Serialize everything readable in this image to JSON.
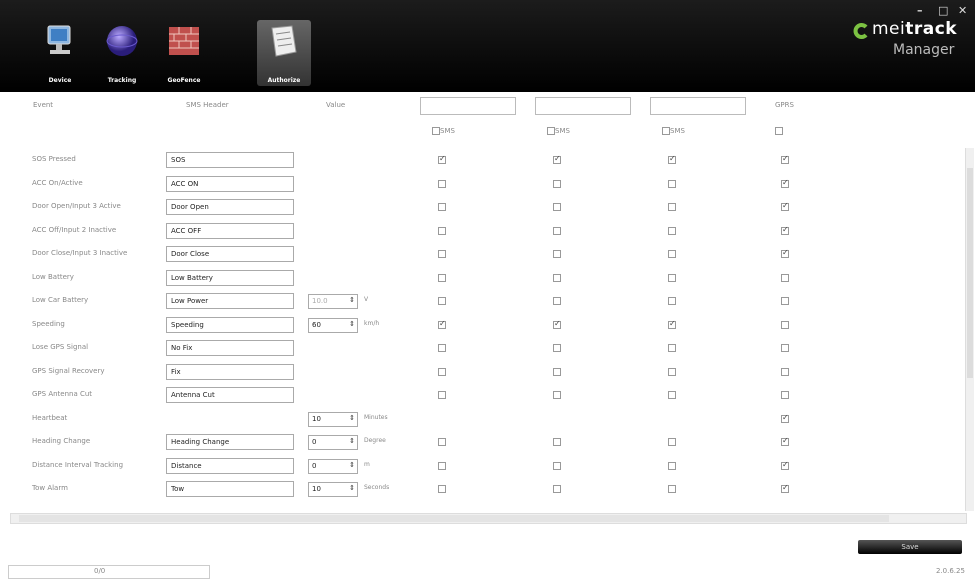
{
  "window": {
    "minimize": "–",
    "maximize": "□",
    "close": "✕"
  },
  "nav": [
    {
      "label": "Device",
      "icon": "device-icon"
    },
    {
      "label": "Tracking",
      "icon": "globe-icon"
    },
    {
      "label": "GeoFence",
      "icon": "wall-icon"
    },
    {
      "label": "Authorize",
      "icon": "authorize-icon",
      "active": true
    }
  ],
  "logo": {
    "brand_a": "mei",
    "brand_b": "track",
    "sub": "Manager"
  },
  "columns": {
    "event": "Event",
    "sms_header": "SMS Header",
    "value": "Value",
    "gprs": "GPRS",
    "sms_label": "SMS"
  },
  "phone_inputs": [
    "",
    "",
    ""
  ],
  "rows": [
    {
      "event": "SOS Pressed",
      "sms": "SOS",
      "value": "",
      "unit": "",
      "c1": true,
      "c2": true,
      "c3": true,
      "gprs": true
    },
    {
      "event": "ACC On/Active",
      "sms": "ACC ON",
      "value": "",
      "unit": "",
      "c1": false,
      "c2": false,
      "c3": false,
      "gprs": true
    },
    {
      "event": "Door Open/Input 3 Active",
      "sms": "Door Open",
      "value": "",
      "unit": "",
      "c1": false,
      "c2": false,
      "c3": false,
      "gprs": true
    },
    {
      "event": "ACC Off/Input 2 Inactive",
      "sms": "ACC OFF",
      "value": "",
      "unit": "",
      "c1": false,
      "c2": false,
      "c3": false,
      "gprs": true
    },
    {
      "event": "Door Close/Input 3 Inactive",
      "sms": "Door Close",
      "value": "",
      "unit": "",
      "c1": false,
      "c2": false,
      "c3": false,
      "gprs": true
    },
    {
      "event": "Low Battery",
      "sms": "Low Battery",
      "value": "",
      "unit": "",
      "c1": false,
      "c2": false,
      "c3": false,
      "gprs": false
    },
    {
      "event": "Low Car Battery",
      "sms": "Low Power",
      "value": "10.0",
      "unit": "V",
      "disabled": true,
      "c1": false,
      "c2": false,
      "c3": false,
      "gprs": false
    },
    {
      "event": "Speeding",
      "sms": "Speeding",
      "value": "60",
      "unit": "km/h",
      "c1": true,
      "c2": true,
      "c3": true,
      "gprs": false
    },
    {
      "event": "Lose GPS Signal",
      "sms": "No Fix",
      "value": "",
      "unit": "",
      "c1": false,
      "c2": false,
      "c3": false,
      "gprs": false
    },
    {
      "event": "GPS Signal Recovery",
      "sms": "Fix",
      "value": "",
      "unit": "",
      "c1": false,
      "c2": false,
      "c3": false,
      "gprs": false
    },
    {
      "event": "GPS Antenna Cut",
      "sms": "Antenna Cut",
      "value": "",
      "unit": "",
      "c1": false,
      "c2": false,
      "c3": false,
      "gprs": false
    },
    {
      "event": "Heartbeat",
      "sms": null,
      "value": "10",
      "unit": "Minutes",
      "c1": null,
      "c2": null,
      "c3": null,
      "gprs": true
    },
    {
      "event": "Heading Change",
      "sms": "Heading Change",
      "value": "0",
      "unit": "Degree",
      "c1": false,
      "c2": false,
      "c3": false,
      "gprs": true
    },
    {
      "event": "Distance Interval Tracking",
      "sms": "Distance",
      "value": "0",
      "unit": "m",
      "c1": false,
      "c2": false,
      "c3": false,
      "gprs": true
    },
    {
      "event": "Tow Alarm",
      "sms": "Tow",
      "value": "10",
      "unit": "Seconds",
      "c1": false,
      "c2": false,
      "c3": false,
      "gprs": true
    }
  ],
  "save_label": "Save",
  "status_text": "0/0",
  "version": "2.0.6.25"
}
